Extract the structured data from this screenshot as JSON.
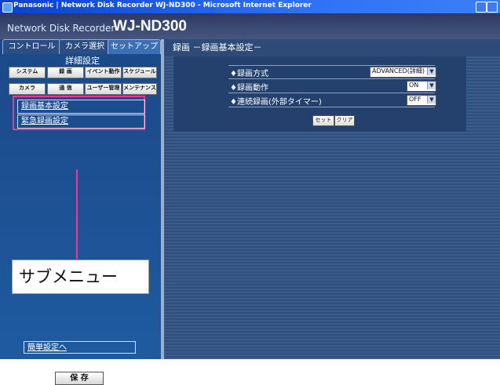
{
  "window": {
    "title": "Panasonic | Network Disk Recorder WJ-ND300 - Microsoft Internet Explorer"
  },
  "header": {
    "product_small": "Network Disk Recorder",
    "product_big": "WJ-ND300"
  },
  "left": {
    "tabs": [
      {
        "label": "コントロール"
      },
      {
        "label": "カメラ選択"
      },
      {
        "label": "セットアップ"
      }
    ],
    "detail_title": "詳細設定",
    "menu_row1": [
      "システム",
      "録 画",
      "イベント動作",
      "スケジュール"
    ],
    "menu_row2": [
      "カメラ",
      "通 信",
      "ユーザー管理",
      "メンテナンス"
    ],
    "submenu": [
      "録画基本設定",
      "緊急録画設定"
    ],
    "callout": "サブメニュー",
    "quick_link": "簡単設定へ",
    "save_label": "保 存"
  },
  "right": {
    "title": "録画 －録画基本設定－",
    "rows": [
      {
        "label": "♦録画方式",
        "value": "ADVANCED(詳細)"
      },
      {
        "label": "♦録画動作",
        "value": "ON"
      },
      {
        "label": "♦連続録画(外部タイマー)",
        "value": "OFF"
      }
    ],
    "set_label": "セット",
    "clear_label": "クリア"
  }
}
